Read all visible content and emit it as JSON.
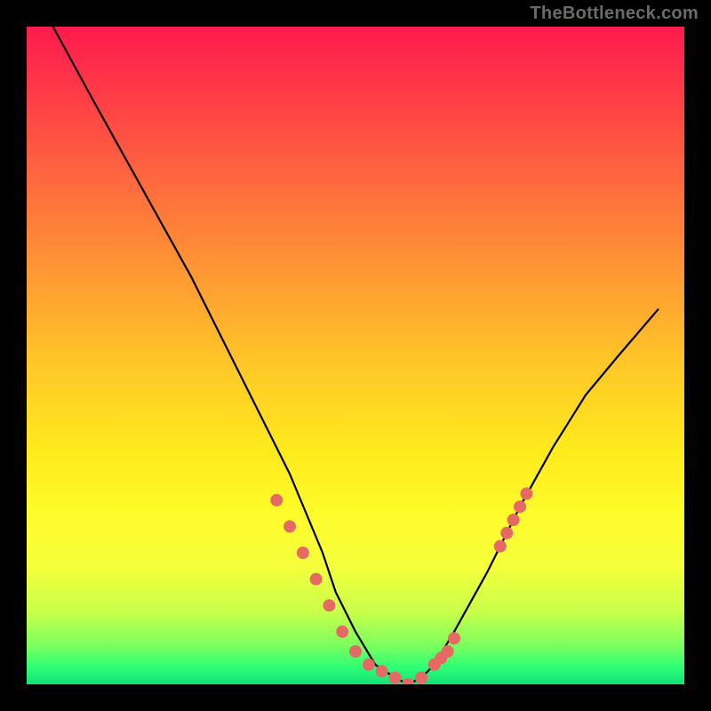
{
  "watermark": "TheBottleneck.com",
  "colors": {
    "background": "#000000",
    "curve_stroke": "#000000",
    "dot_fill": "#e66a63",
    "gradient_top": "#ff1a4d",
    "gradient_bottom": "#13e07a"
  },
  "chart_data": {
    "type": "line",
    "title": "",
    "xlabel": "",
    "ylabel": "",
    "x_range": [
      0,
      100
    ],
    "y_range": [
      0,
      100
    ],
    "gradient_meaning": "vertical color ramp red→yellow→green indicating bottleneck severity (top=bad, bottom=good)",
    "series": [
      {
        "name": "bottleneck-curve",
        "x": [
          4,
          10,
          15,
          20,
          25,
          30,
          35,
          40,
          45,
          47,
          50,
          53,
          56,
          58,
          60,
          62,
          65,
          70,
          75,
          80,
          85,
          90,
          96
        ],
        "y": [
          100,
          89,
          80,
          71,
          62,
          52,
          42,
          32,
          20,
          14,
          8,
          3,
          1,
          0,
          1,
          3,
          8,
          17,
          27,
          36,
          44,
          50,
          57
        ]
      }
    ],
    "markers": {
      "name": "highlighted-points",
      "note": "salmon dots clustered near trough and lower-right segment",
      "x": [
        38,
        40,
        42,
        44,
        46,
        48,
        50,
        52,
        54,
        56,
        58,
        60,
        62,
        63,
        64,
        65,
        72,
        73,
        74,
        75,
        76
      ],
      "y": [
        28,
        24,
        20,
        16,
        12,
        8,
        5,
        3,
        2,
        1,
        0,
        1,
        3,
        4,
        5,
        7,
        21,
        23,
        25,
        27,
        29
      ]
    }
  }
}
